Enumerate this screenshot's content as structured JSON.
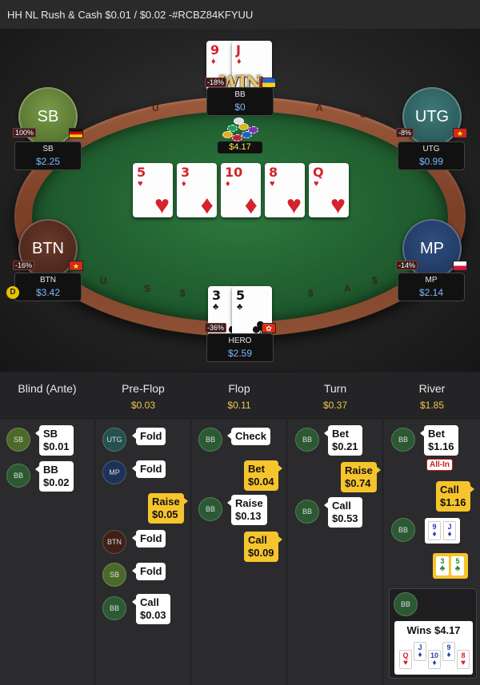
{
  "header": {
    "title": "HH NL Rush & Cash $0.01 / $0.02 -#RCBZ84KFYUU"
  },
  "colors": {
    "felt": "#1f5c2e",
    "rail": "#8e5034",
    "stack_text": "#7fb6ff",
    "pot_text": "#ffe34d",
    "street_value": "#f0c94a",
    "aggressive_bubble": "#f6c42c"
  },
  "table": {
    "rail_text": "S U S A S",
    "pot": "$4.17",
    "win_badge": "WIN",
    "dealer_button": "D",
    "seats": {
      "bb": {
        "name": "BB",
        "stack": "$0",
        "pct": "-18%",
        "flag": "ukraine-flag",
        "cards": [
          {
            "rank": "9",
            "suit": "♦",
            "color": "red"
          },
          {
            "rank": "J",
            "suit": "♦",
            "color": "red"
          }
        ]
      },
      "sb": {
        "avatar": "SB",
        "name": "SB",
        "stack": "$2.25",
        "pct": "100%",
        "flag": "germany-flag"
      },
      "utg": {
        "avatar": "UTG",
        "name": "UTG",
        "stack": "$0.99",
        "pct": "-8%",
        "flag": "vietnam-flag"
      },
      "btn": {
        "avatar": "BTN",
        "name": "BTN",
        "stack": "$3.42",
        "pct": "-16%",
        "flag": "vietnam-flag"
      },
      "mp": {
        "avatar": "MP",
        "name": "MP",
        "stack": "$2.14",
        "pct": "-14%",
        "flag": "poland-flag"
      },
      "hero": {
        "name": "HERO",
        "stack": "$2.59",
        "pct": "-36%",
        "flag": "hong-kong-flag",
        "cards": [
          {
            "rank": "3",
            "suit": "♣",
            "color": "blk"
          },
          {
            "rank": "5",
            "suit": "♣",
            "color": "blk"
          }
        ]
      }
    },
    "board": [
      {
        "rank": "5",
        "suit": "♥",
        "color": "red"
      },
      {
        "rank": "3",
        "suit": "♦",
        "color": "red"
      },
      {
        "rank": "10",
        "suit": "♦",
        "color": "red"
      },
      {
        "rank": "8",
        "suit": "♥",
        "color": "red"
      },
      {
        "rank": "Q",
        "suit": "♥",
        "color": "red"
      }
    ]
  },
  "history": {
    "streets": [
      {
        "title": "Blind (Ante)",
        "value": ""
      },
      {
        "title": "Pre-Flop",
        "value": "$0.03"
      },
      {
        "title": "Flop",
        "value": "$0.11"
      },
      {
        "title": "Turn",
        "value": "$0.37"
      },
      {
        "title": "River",
        "value": "$1.85"
      }
    ],
    "blind": [
      {
        "pos": "SB",
        "action": "SB",
        "amount": "$0.01"
      },
      {
        "pos": "BB",
        "action": "BB",
        "amount": "$0.02"
      }
    ],
    "preflop": [
      {
        "pos": "UTG",
        "action": "Fold"
      },
      {
        "pos": "MP",
        "action": "Fold"
      },
      {
        "action": "Raise",
        "amount": "$0.05"
      },
      {
        "pos": "BTN",
        "action": "Fold"
      },
      {
        "pos": "SB",
        "action": "Fold"
      },
      {
        "pos": "BB",
        "action": "Call",
        "amount": "$0.03"
      }
    ],
    "flop": [
      {
        "pos": "BB",
        "action": "Check"
      },
      {
        "action": "Bet",
        "amount": "$0.04"
      },
      {
        "pos": "BB",
        "action": "Raise",
        "amount": "$0.13"
      },
      {
        "action": "Call",
        "amount": "$0.09"
      }
    ],
    "turn": [
      {
        "pos": "BB",
        "action": "Bet",
        "amount": "$0.21"
      },
      {
        "action": "Raise",
        "amount": "$0.74"
      },
      {
        "pos": "BB",
        "action": "Call",
        "amount": "$0.53"
      }
    ],
    "river": [
      {
        "pos": "BB",
        "action": "Bet",
        "amount": "$1.16",
        "tag": "All-In"
      },
      {
        "action": "Call",
        "amount": "$1.16"
      },
      {
        "pos": "BB",
        "shown": [
          "9♦",
          "J♦"
        ]
      },
      {
        "shown": [
          "3♣",
          "5♣"
        ]
      }
    ],
    "winner": {
      "pos": "BB",
      "text": "Wins $4.17",
      "hand": [
        {
          "rank": "Q",
          "suit": "♥",
          "color": "red"
        },
        {
          "rank": "J",
          "suit": "♦",
          "color": "blue"
        },
        {
          "rank": "10",
          "suit": "♦",
          "color": "blue"
        },
        {
          "rank": "9",
          "suit": "♦",
          "color": "blue"
        },
        {
          "rank": "8",
          "suit": "♥",
          "color": "red"
        }
      ]
    }
  }
}
